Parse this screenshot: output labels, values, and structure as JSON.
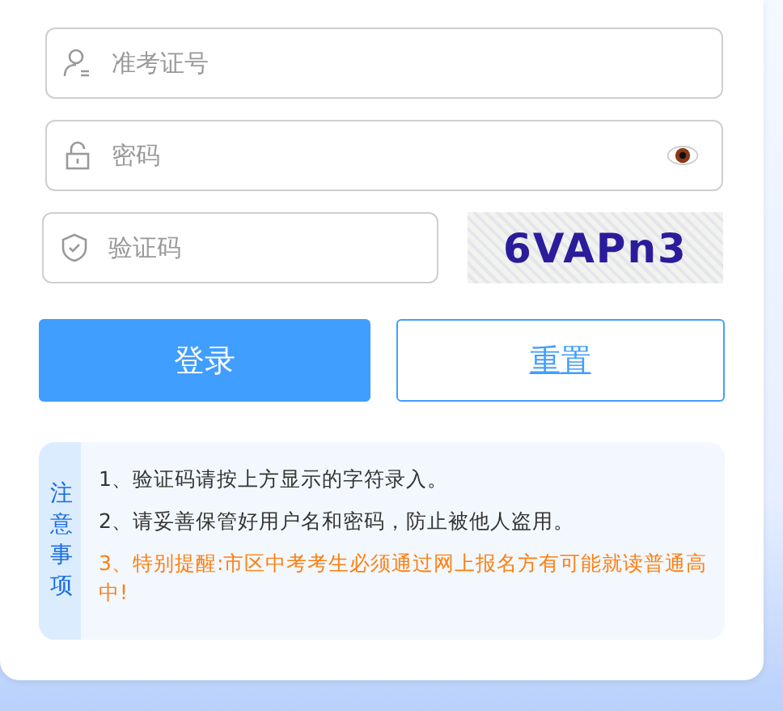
{
  "form": {
    "fields": [
      {
        "kind": "user",
        "placeholder": "准考证号"
      },
      {
        "kind": "password",
        "placeholder": "密码"
      },
      {
        "kind": "captcha",
        "placeholder": "验证码"
      }
    ],
    "captcha": {
      "text": "6VAPn3"
    },
    "buttons": [
      {
        "label": "登录",
        "kind": "primary"
      },
      {
        "label": "重置",
        "kind": "link"
      }
    ]
  },
  "notice": {
    "title": "注意事项",
    "items": [
      {
        "text": "1、验证码请按上方显示的字符录入。",
        "kind": "normal"
      },
      {
        "text": "2、请妥善保管好用户名和密码，防止被他人盗用。",
        "kind": "normal"
      },
      {
        "text": "3、特别提醒:市区中考考生必须通过网上报名方有可能就读普通高中!",
        "kind": "warning"
      }
    ]
  }
}
